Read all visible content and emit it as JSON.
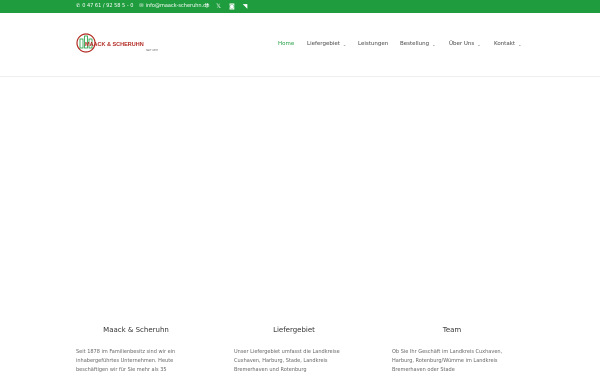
{
  "topbar": {
    "phone": "0 47 61 / 92 58 5 - 0",
    "email": "info@maack-scheruhn.de",
    "social": [
      "facebook-icon",
      "x-icon",
      "instagram-icon",
      "rss-icon"
    ]
  },
  "brand": {
    "name": "MAACK & SCHERUHN",
    "tagline": "SEIT 1878",
    "colors": {
      "red": "#b32b24",
      "green": "#1f9d3e"
    }
  },
  "nav": {
    "home": "Home",
    "liefergebiet": "Liefergebiet",
    "leistungen": "Leistungen",
    "bestellung": "Bestellung",
    "ueber_uns": "Über Uns",
    "kontakt": "Kontakt"
  },
  "columns": [
    {
      "title": "Maack & Scheruhn",
      "text": "Seit 1878 im Familienbesitz sind wir ein inhabergeführtes Unternehmen. Heute beschäftigen wir für Sie mehr als 35"
    },
    {
      "title": "Liefergebiet",
      "text": "Unser Liefergebiet umfasst die Landkreise Cuxhaven, Harburg, Stade, Landkreis Bremerhaven und Rotenburg"
    },
    {
      "title": "Team",
      "text": "Ob Sie Ihr Geschäft im Landkreis Cuxhaven, Harburg, Rotenburg/Wümme im Landkreis Bremerhaven oder Stade"
    }
  ]
}
